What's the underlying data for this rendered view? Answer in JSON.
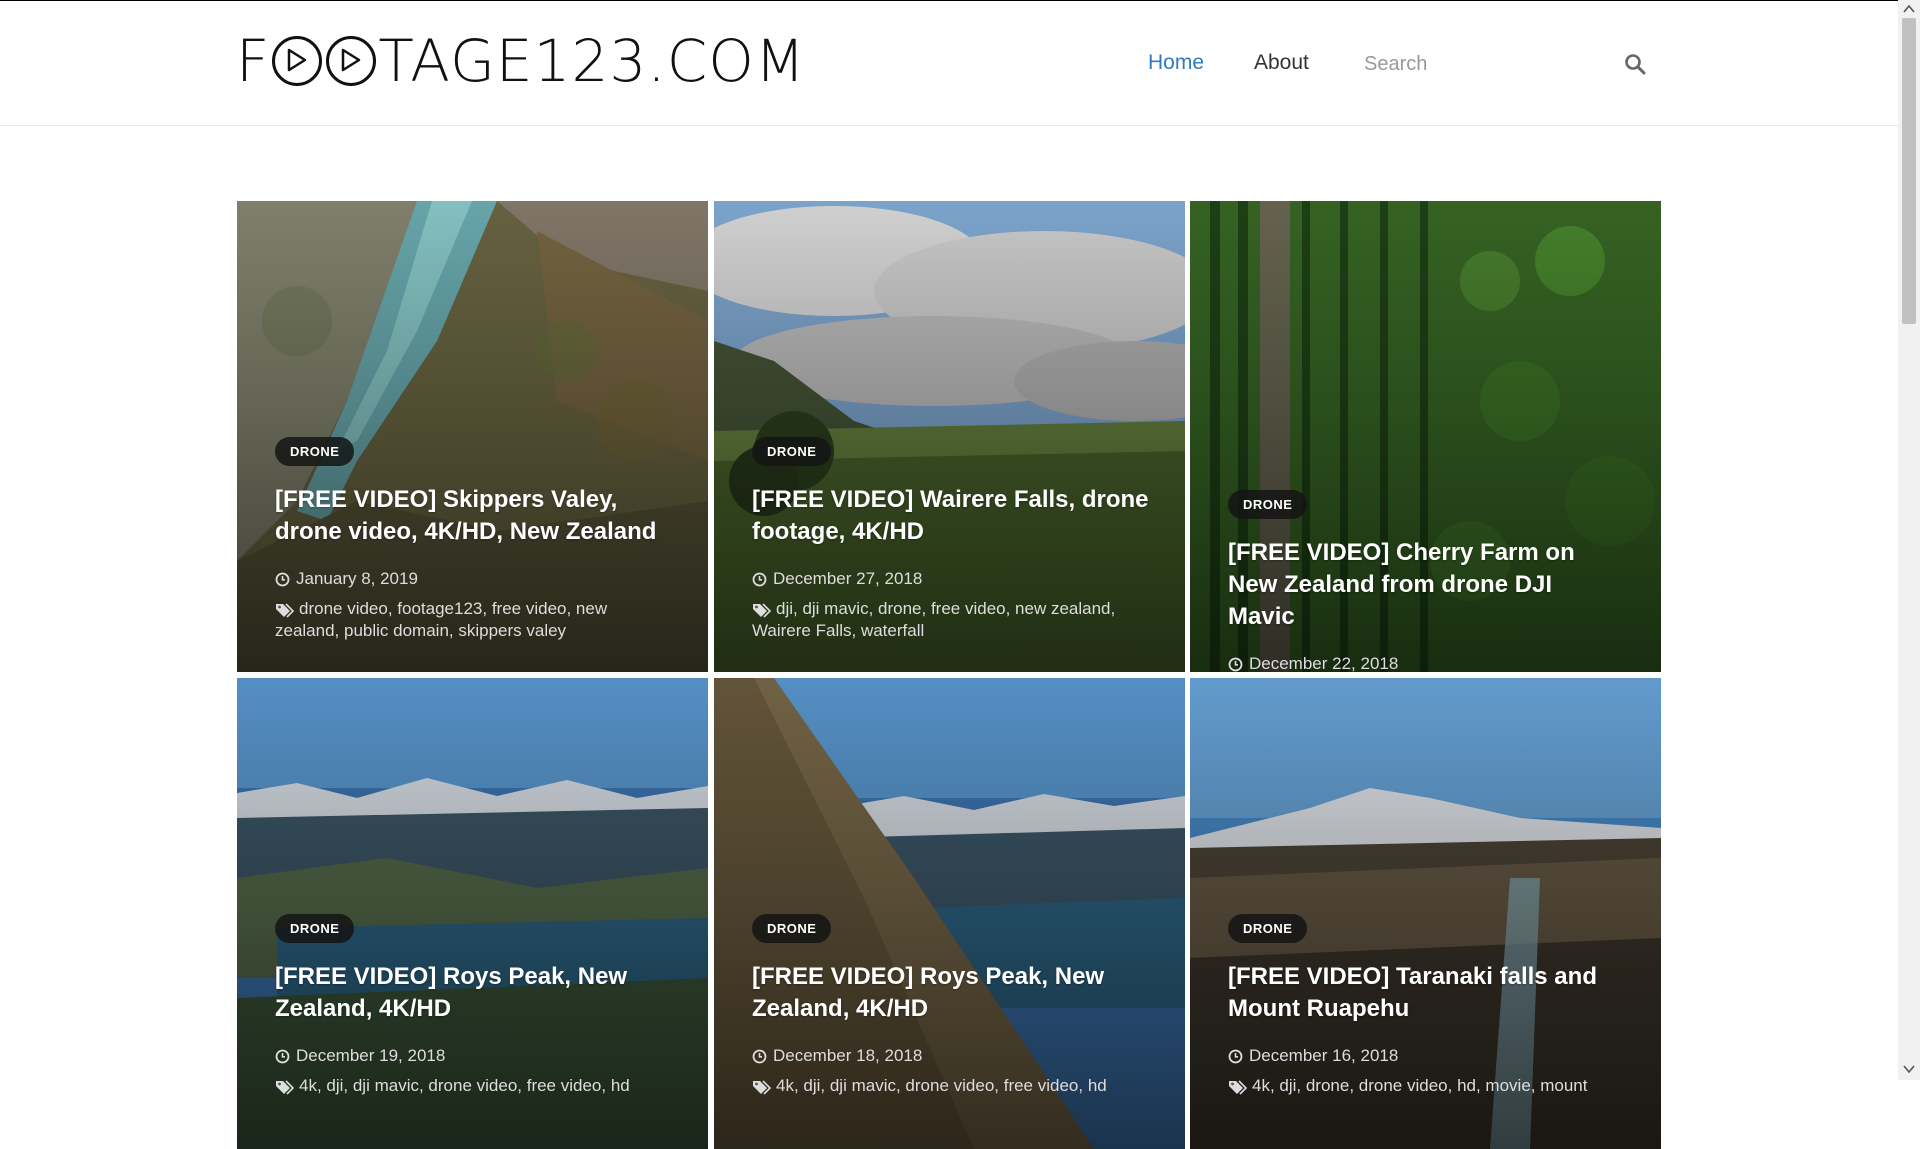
{
  "site": {
    "logo_text": "FOOTAGE123.COM"
  },
  "nav": {
    "home": "Home",
    "about": "About",
    "search_placeholder": "Search"
  },
  "colors": {
    "accent": "#2e7bc4",
    "badge_bg": "#141414"
  },
  "icons": {
    "search": "search-icon",
    "date": "clock-icon",
    "tags": "tags-icon"
  },
  "posts": [
    {
      "category": "DRONE",
      "title": "[FREE VIDEO] Skippers Valey, drone video, 4K/HD, New Zealand",
      "date": "January 8, 2019",
      "tags": "drone video, footage123, free video, new zealand, public domain, skippers valey"
    },
    {
      "category": "DRONE",
      "title": "[FREE VIDEO] Wairere Falls, drone footage, 4K/HD",
      "date": "December 27, 2018",
      "tags": "dji, dji mavic, drone, free video, new zealand, Wairere Falls, waterfall"
    },
    {
      "category": "DRONE",
      "title": "[FREE VIDEO] Cherry Farm on New Zealand from drone DJI Mavic",
      "date": "December 22, 2018",
      "tags": ""
    },
    {
      "category": "DRONE",
      "title": "[FREE VIDEO] Roys Peak, New Zealand, 4K/HD",
      "date": "December 19, 2018",
      "tags": "4k, dji, dji mavic, drone video, free video, hd"
    },
    {
      "category": "DRONE",
      "title": "[FREE VIDEO] Roys Peak, New Zealand, 4K/HD",
      "date": "December 18, 2018",
      "tags": "4k, dji, dji mavic, drone video, free video, hd"
    },
    {
      "category": "DRONE",
      "title": "[FREE VIDEO] Taranaki falls and Mount Ruapehu",
      "date": "December 16, 2018",
      "tags": "4k, dji, drone, drone video, hd, movie, mount"
    }
  ]
}
